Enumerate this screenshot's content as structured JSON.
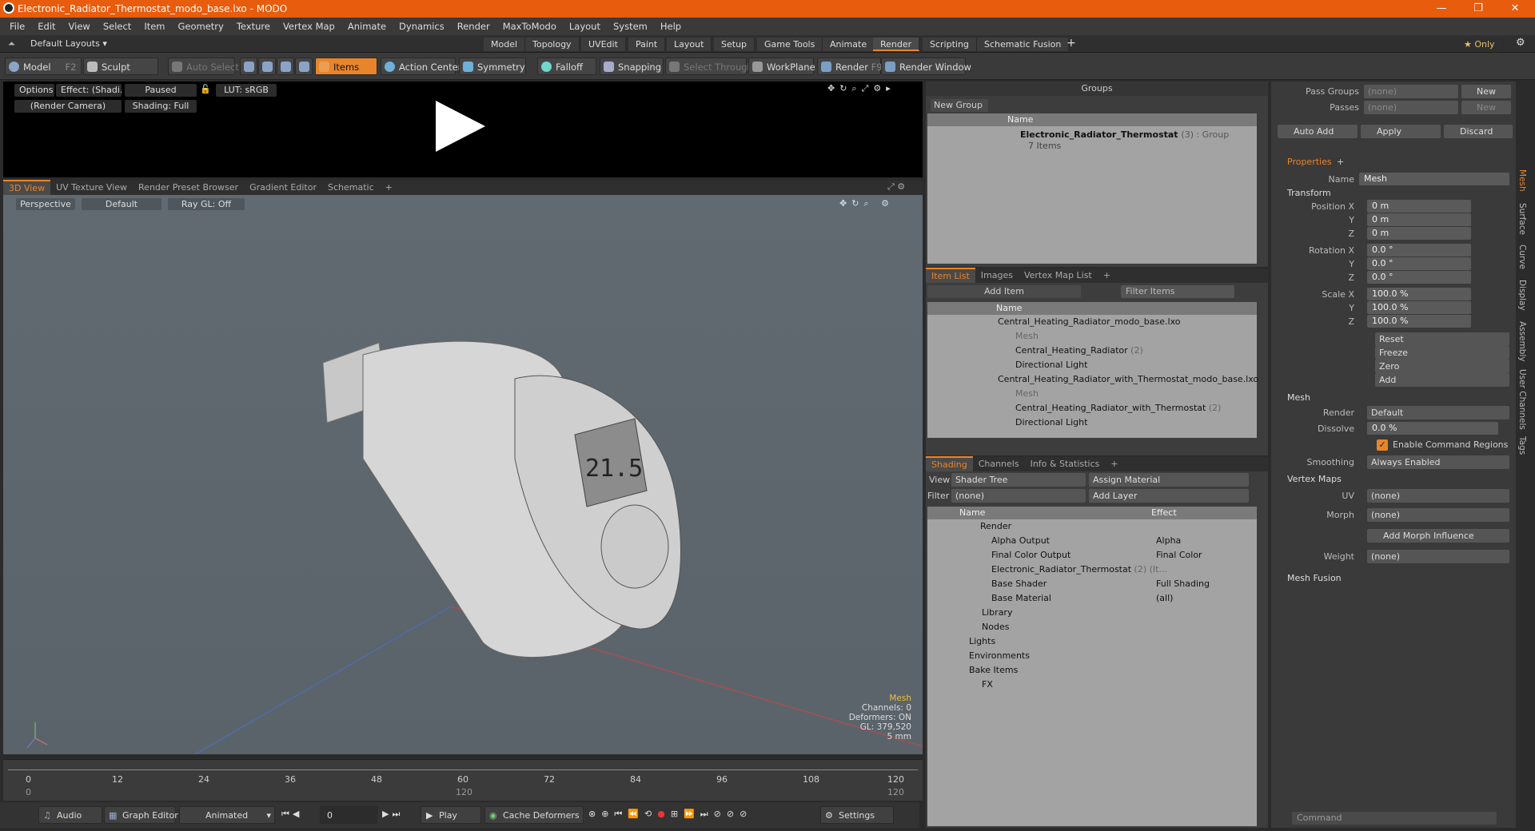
{
  "window": {
    "title": "Electronic_Radiator_Thermostat_modo_base.lxo - MODO",
    "minimize": "—",
    "restore": "❐",
    "close": "✕"
  },
  "menu": [
    "File",
    "Edit",
    "View",
    "Select",
    "Item",
    "Geometry",
    "Texture",
    "Vertex Map",
    "Animate",
    "Dynamics",
    "Render",
    "MaxToModo",
    "Layout",
    "System",
    "Help"
  ],
  "layouts": {
    "label": "Default Layouts",
    "tabs": [
      "Model",
      "Topology",
      "UVEdit",
      "Paint",
      "Layout",
      "Setup",
      "Game Tools",
      "Animate",
      "Render",
      "Scripting",
      "Schematic Fusion"
    ],
    "active": "Render",
    "add": "+",
    "only": "Only"
  },
  "toolbar": {
    "model": "Model",
    "model_key": "F2",
    "sculpt": "Sculpt",
    "auto_select": "Auto Select",
    "items": "Items",
    "action_center": "Action Center",
    "symmetry": "Symmetry",
    "falloff": "Falloff",
    "snapping": "Snapping",
    "select_through": "Select Through",
    "workplane": "WorkPlane",
    "render": "Render",
    "render_key": "F9",
    "render_window": "Render Window"
  },
  "preview": {
    "options": "Options",
    "effect": "Effect: (Shadi...",
    "paused": "Paused",
    "lut": "LUT: sRGB",
    "camera": "(Render Camera)",
    "shading": "Shading: Full"
  },
  "viewtabs": [
    "3D View",
    "UV Texture View",
    "Render Preset Browser",
    "Gradient Editor",
    "Schematic",
    "+"
  ],
  "viewport": {
    "perspective": "Perspective",
    "default": "Default",
    "raygl": "Ray GL: Off",
    "hud": {
      "title": "Mesh",
      "channels": "Channels: 0",
      "deformers": "Deformers: ON",
      "gl": "GL: 379,520",
      "scale": "5 mm"
    }
  },
  "timeline": {
    "ticks": [
      "0",
      "12",
      "24",
      "36",
      "48",
      "60",
      "72",
      "84",
      "96",
      "108",
      "120"
    ],
    "sub": [
      "0",
      "120",
      "120"
    ]
  },
  "bottom": {
    "audio": "Audio",
    "graph_editor": "Graph Editor",
    "animated": "Animated",
    "frame": "0",
    "play": "Play",
    "cache": "Cache Deformers",
    "settings": "Settings"
  },
  "groups": {
    "title": "Groups",
    "new_group": "New Group",
    "name_col": "Name",
    "item": "Electronic_Radiator_Thermostat",
    "item_meta": "(3) : Group",
    "item_sub": "7 Items"
  },
  "itemlist": {
    "tabs": [
      "Item List",
      "Images",
      "Vertex Map List",
      "+"
    ],
    "add_item": "Add Item",
    "filter": "Filter Items",
    "name_col": "Name",
    "rows": [
      "Central_Heating_Radiator_modo_base.lxo",
      "Mesh",
      "Central_Heating_Radiator",
      "Directional Light",
      "Central_Heating_Radiator_with_Thermostat_modo_base.lxo",
      "Mesh",
      "Central_Heating_Radiator_with_Thermostat",
      "Directional Light"
    ],
    "counts": [
      "(2)",
      "(2)"
    ]
  },
  "shading": {
    "tabs": [
      "Shading",
      "Channels",
      "Info & Statistics",
      "+"
    ],
    "view_label": "View",
    "view": "Shader Tree",
    "assign": "Assign Material",
    "filter_label": "Filter",
    "filter": "(none)",
    "add_layer": "Add Layer",
    "name_col": "Name",
    "effect_col": "Effect",
    "rows": [
      "Render",
      "Alpha Output",
      "Final Color Output",
      "Electronic_Radiator_Thermostat",
      "Base Shader",
      "Base Material",
      "Library",
      "Nodes",
      "Lights",
      "Environments",
      "Bake Items",
      "FX"
    ],
    "thermo_meta": "(2) (It...",
    "effects": [
      "Alpha",
      "Final Color",
      "",
      "Full Shading",
      "(all)"
    ]
  },
  "right": {
    "pass_groups": "Pass Groups",
    "passes": "Passes",
    "none": "(none)",
    "new": "New",
    "auto_add": "Auto Add",
    "apply": "Apply",
    "discard": "Discard",
    "properties": "Properties",
    "plus": "+",
    "name_label": "Name",
    "name": "Mesh",
    "transform": "Transform",
    "pos_label": "Position X",
    "rot_label": "Rotation X",
    "scale_label": "Scale X",
    "y": "Y",
    "z": "Z",
    "pos": [
      "0 m",
      "0 m",
      "0 m"
    ],
    "rot": [
      "0.0 °",
      "0.0 °",
      "0.0 °"
    ],
    "scale": [
      "100.0 %",
      "100.0 %",
      "100.0 %"
    ],
    "actions": [
      "Reset",
      "Freeze",
      "Zero",
      "Add"
    ],
    "mesh": "Mesh",
    "render_label": "Render",
    "render": "Default",
    "dissolve_label": "Dissolve",
    "dissolve": "0.0 %",
    "enable_cmd": "Enable Command Regions",
    "smoothing_label": "Smoothing",
    "smoothing": "Always Enabled",
    "vertex_maps": "Vertex Maps",
    "uv_label": "UV",
    "morph_label": "Morph",
    "add_morph": "Add Morph Influence",
    "weight_label": "Weight",
    "mesh_fusion": "Mesh Fusion",
    "command": "Command",
    "sidetabs": [
      "Mesh",
      "Surface",
      "Curve",
      "Display",
      "Assembly",
      "User Channels",
      "Tags"
    ]
  },
  "colors": {
    "accent": "#e8852a",
    "title": "#e85c0d"
  }
}
